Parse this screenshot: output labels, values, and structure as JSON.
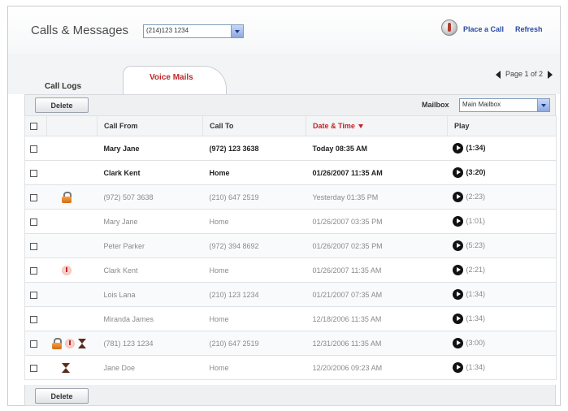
{
  "header": {
    "title": "Calls & Messages",
    "number_select": "(214)123 1234",
    "place_call": "Place a Call",
    "refresh": "Refresh"
  },
  "tabs": [
    {
      "label": "Call Logs",
      "active": false
    },
    {
      "label": "Voice Mails",
      "active": true
    }
  ],
  "pager": {
    "label": "Page 1 of 2"
  },
  "toolbar": {
    "delete_label": "Delete",
    "mailbox_label": "Mailbox",
    "mailbox_value": "Main Mailbox"
  },
  "table": {
    "headers": {
      "call_from": "Call From",
      "call_to": "Call To",
      "date_time": "Date & Time",
      "play": "Play"
    },
    "rows": [
      {
        "from": "Mary Jane",
        "to": "(972) 123 3638",
        "date": "Today 08:35 AM",
        "duration": "(1:34)",
        "unread": true,
        "icons": []
      },
      {
        "from": "Clark Kent",
        "to": "Home",
        "date": "01/26/2007 11:35 AM",
        "duration": "(3:20)",
        "unread": true,
        "icons": []
      },
      {
        "from": "(972) 507 3638",
        "to": "(210) 647 2519",
        "date": "Yesterday 01:35 PM",
        "duration": "(2:23)",
        "unread": false,
        "icons": [
          "lock"
        ]
      },
      {
        "from": "Mary Jane",
        "to": "Home",
        "date": "01/26/2007 03:35 PM",
        "duration": "(1:01)",
        "unread": false,
        "icons": []
      },
      {
        "from": "Peter Parker",
        "to": "(972) 394 8692",
        "date": "01/26/2007 02:35 PM",
        "duration": "(5:23)",
        "unread": false,
        "icons": []
      },
      {
        "from": "Clark Kent",
        "to": "Home",
        "date": "01/26/2007 11:35 AM",
        "duration": "(2:21)",
        "unread": false,
        "icons": [
          "urgent"
        ]
      },
      {
        "from": "Lois Lana",
        "to": "(210) 123 1234",
        "date": "01/21/2007 07:35 AM",
        "duration": "(1:34)",
        "unread": false,
        "icons": []
      },
      {
        "from": "Miranda James",
        "to": "Home",
        "date": "12/18/2006 11:35 AM",
        "duration": "(1:34)",
        "unread": false,
        "icons": []
      },
      {
        "from": "(781) 123 1234",
        "to": "(210) 647 2519",
        "date": "12/31/2006 11:35 AM",
        "duration": "(3:00)",
        "unread": false,
        "icons": [
          "lock",
          "urgent",
          "hourglass"
        ]
      },
      {
        "from": "Jane Doe",
        "to": "Home",
        "date": "12/20/2006 09:23 AM",
        "duration": "(1:34)",
        "unread": false,
        "icons": [
          "hourglass"
        ]
      }
    ]
  },
  "bottom": {
    "delete_label": "Delete"
  },
  "colors": {
    "accent_red": "#c0262b",
    "link_blue": "#2a4aa6"
  }
}
